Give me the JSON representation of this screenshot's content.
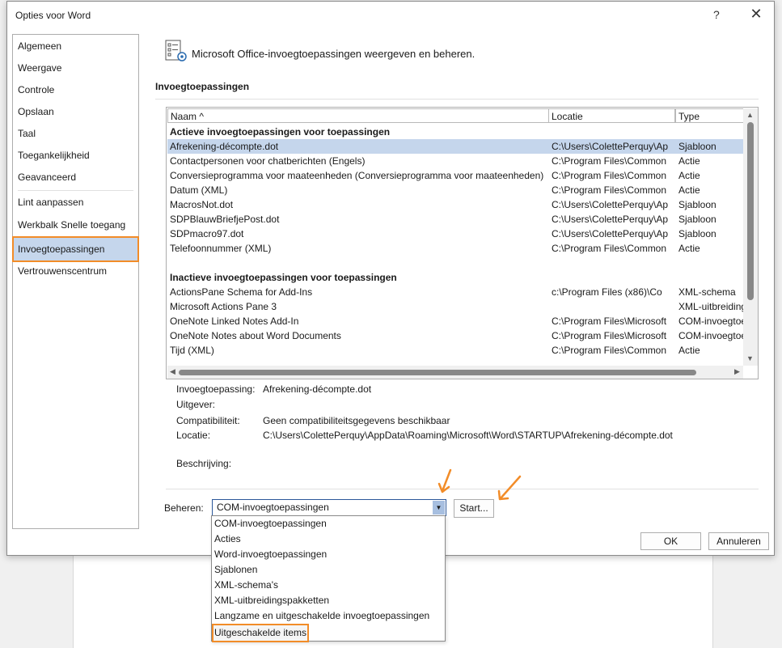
{
  "window": {
    "title": "Opties voor Word",
    "help": "?",
    "close": "✕"
  },
  "nav": {
    "items": [
      "Algemeen",
      "Weergave",
      "Controle",
      "Opslaan",
      "Taal",
      "Toegankelijkheid",
      "Geavanceerd",
      "Lint aanpassen",
      "Werkbalk Snelle toegang",
      "Invoegtoepassingen",
      "Vertrouwenscentrum"
    ],
    "selected": "Invoegtoepassingen"
  },
  "header": {
    "text": "Microsoft Office-invoegtoepassingen weergeven en beheren."
  },
  "section": {
    "title": "Invoegtoepassingen"
  },
  "table": {
    "columns": [
      "Naam ^",
      "Locatie",
      "Type"
    ],
    "groups": [
      {
        "title": "Actieve invoegtoepassingen voor toepassingen",
        "rows": [
          [
            "Afrekening-décompte.dot",
            "C:\\Users\\ColettePerquy\\Ap",
            "Sjabloon"
          ],
          [
            "Contactpersonen voor chatberichten (Engels)",
            "C:\\Program Files\\Common",
            "Actie"
          ],
          [
            "Conversieprogramma voor maateenheden (Conversieprogramma voor maateenheden)",
            "C:\\Program Files\\Common",
            "Actie"
          ],
          [
            "Datum (XML)",
            "C:\\Program Files\\Common",
            "Actie"
          ],
          [
            "MacrosNot.dot",
            "C:\\Users\\ColettePerquy\\Ap",
            "Sjabloon"
          ],
          [
            "SDPBlauwBriefjePost.dot",
            "C:\\Users\\ColettePerquy\\Ap",
            "Sjabloon"
          ],
          [
            "SDPmacro97.dot",
            "C:\\Users\\ColettePerquy\\Ap",
            "Sjabloon"
          ],
          [
            "Telefoonnummer (XML)",
            "C:\\Program Files\\Common",
            "Actie"
          ]
        ]
      },
      {
        "title": "Inactieve invoegtoepassingen voor toepassingen",
        "rows": [
          [
            "ActionsPane Schema for Add-Ins",
            "c:\\Program Files (x86)\\Co",
            "XML-schema"
          ],
          [
            "Microsoft Actions Pane 3",
            "",
            "XML-uitbreidings"
          ],
          [
            "OneNote Linked Notes Add-In",
            "C:\\Program Files\\Microsoft",
            "COM-invoegtoe"
          ],
          [
            "OneNote Notes about Word Documents",
            "C:\\Program Files\\Microsoft",
            "COM-invoegtoe"
          ],
          [
            "Tijd (XML)",
            "C:\\Program Files\\Common",
            "Actie"
          ]
        ]
      }
    ]
  },
  "details": [
    {
      "label": "Invoegtoepassing:",
      "value": "Afrekening-décompte.dot"
    },
    {
      "label": "Uitgever:",
      "value": ""
    },
    {
      "label": "Compatibiliteit:",
      "value": "Geen compatibiliteitsgegevens beschikbaar"
    },
    {
      "label": "Locatie:",
      "value": "C:\\Users\\ColettePerquy\\AppData\\Roaming\\Microsoft\\Word\\STARTUP\\Afrekening-décompte.dot"
    },
    {
      "label": "Beschrijving:",
      "value": ""
    }
  ],
  "manage": {
    "label": "Beheren:",
    "selected": "COM-invoegtoepassingen",
    "start": "Start...",
    "options": [
      "COM-invoegtoepassingen",
      "Acties",
      "Word-invoegtoepassingen",
      "Sjablonen",
      "XML-schema's",
      "XML-uitbreidingspakketten",
      "Langzame en uitgeschakelde invoegtoepassingen",
      "Uitgeschakelde items"
    ]
  },
  "buttons": {
    "ok": "OK",
    "cancel": "Annuleren"
  },
  "colors": {
    "accent": "#f28c28",
    "selection": "#c5d6ec"
  }
}
